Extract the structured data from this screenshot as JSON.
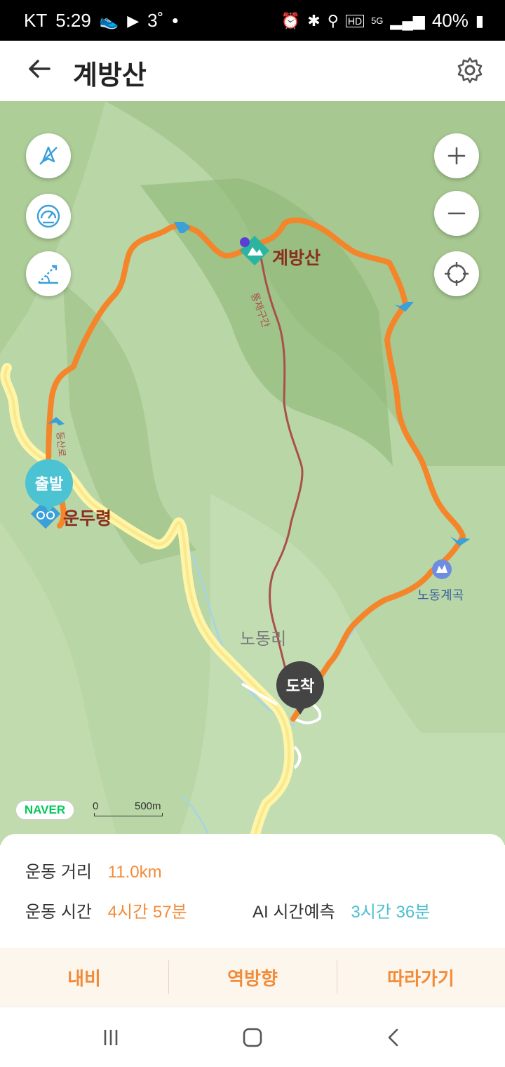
{
  "status_bar": {
    "carrier": "KT",
    "time": "5:29",
    "temperature": "3˚",
    "dot": "•",
    "battery": "40%",
    "network": "5G",
    "hd": "HD"
  },
  "header": {
    "title": "계방산",
    "back_icon": "arrow-left-icon",
    "settings_icon": "gear-icon"
  },
  "map": {
    "labels": {
      "peak": "계방산",
      "start_place": "운두령",
      "valley": "노동계곡",
      "village": "노동리",
      "trail_segment": "등산로",
      "trail_segment2": "통제구간"
    },
    "pins": {
      "start": "출발",
      "end": "도착"
    },
    "attribution": "NAVER",
    "scale": {
      "zero": "0",
      "distance": "500m"
    },
    "left_controls": [
      "compass-off-icon",
      "speed-gauge-icon",
      "elevation-icon"
    ],
    "right_controls": [
      "zoom-in-icon",
      "zoom-out-icon",
      "locate-icon"
    ],
    "colors": {
      "route": "#f5852b",
      "road": "#fff3a8",
      "start_pin": "#4cc3d3",
      "end_pin": "#444444",
      "closed_trail": "#a9504a"
    }
  },
  "stats": {
    "distance_label": "운동 거리",
    "distance_value": "11.0km",
    "time_label": "운동 시간",
    "time_value": "4시간 57분",
    "ai_label": "AI 시간예측",
    "ai_value": "3시간 36분",
    "colors": {
      "orange": "#f28c3a",
      "teal": "#4bbfcf"
    }
  },
  "actions": {
    "navi": "내비",
    "reverse": "역방향",
    "follow": "따라가기"
  },
  "nav_bar": [
    "recent-apps-icon",
    "home-icon",
    "back-icon"
  ]
}
